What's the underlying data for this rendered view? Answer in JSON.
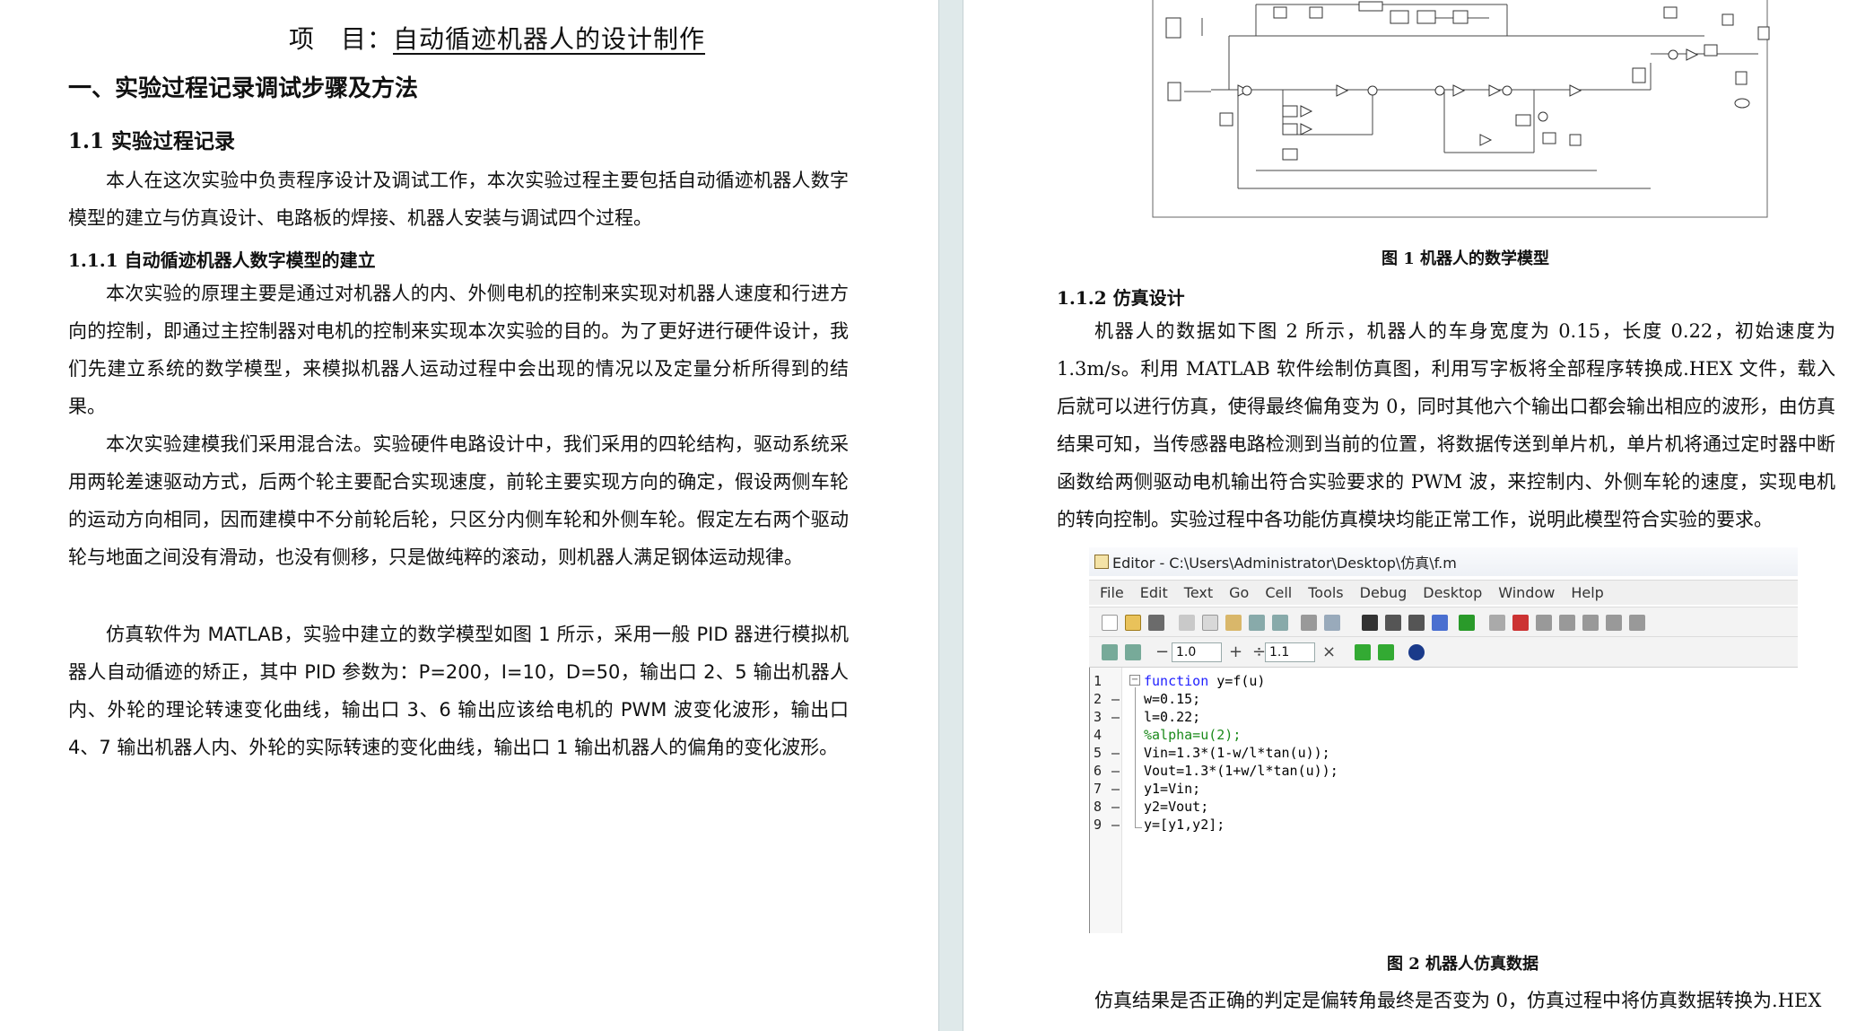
{
  "left": {
    "project_label": "项　目：",
    "project_value": "自动循迹机器人的设计制作",
    "section_heading": "一、实验过程记录调试步骤及方法",
    "sub_1_1": "1.1 实验过程记录",
    "p1": "本人在这次实验中负责程序设计及调试工作，本次实验过程主要包括自动循迹机器人数字模型的建立与仿真设计、电路板的焊接、机器人安装与调试四个过程。",
    "sub_1_1_1": "1.1.1 自动循迹机器人数字模型的建立",
    "p2": "本次实验的原理主要是通过对机器人的内、外侧电机的控制来实现对机器人速度和行进方向的控制，即通过主控制器对电机的控制来实现本次实验的目的。为了更好进行硬件设计，我们先建立系统的数学模型，来模拟机器人运动过程中会出现的情况以及定量分析所得到的结果。",
    "p3": "本次实验建模我们采用混合法。实验硬件电路设计中，我们采用的四轮结构，驱动系统采用两轮差速驱动方式，后两个轮主要配合实现速度，前轮主要实现方向的确定，假设两侧车轮的运动方向相同，因而建模中不分前轮后轮，只区分内侧车轮和外侧车轮。假定左右两个驱动轮与地面之间没有滑动，也没有侧移，只是做纯粹的滚动，则机器人满足钢体运动规律。",
    "p4": "仿真软件为 MATLAB，实验中建立的数学模型如图 1 所示，采用一般 PID 器进行模拟机器人自动循迹的矫正，其中 PID 参数为：P=200，I=10，D=50，输出口 2、5 输出机器人内、外轮的理论转速变化曲线，输出口 3、6 输出应该给电机的 PWM 波变化波形，输出口 4、7 输出机器人内、外轮的实际转速的变化曲线，输出口 1 输出机器人的偏角的变化波形。"
  },
  "right": {
    "fig1_caption": "图 1  机器人的数学模型",
    "sub_1_1_2": "1.1.2 仿真设计",
    "p5": "机器人的数据如下图 2 所示，机器人的车身宽度为 0.15，长度 0.22，初始速度为 1.3m/s。利用 MATLAB 软件绘制仿真图，利用写字板将全部程序转换成.HEX 文件，载入后就可以进行仿真，使得最终偏角变为 0，同时其他六个输出口都会输出相应的波形，由仿真结果可知，当传感器电路检测到当前的位置，将数据传送到单片机，单片机将通过定时器中断函数给两侧驱动电机输出符合实验要求的 PWM 波，来控制内、外侧车轮的速度，实现电机的转向控制。实验过程中各功能仿真模块均能正常工作，说明此模型符合实验的要求。",
    "fig2_caption": "图 2  机器人仿真数据",
    "p6": "仿真结果是否正确的判定是偏转角最终是否变为 0，仿真过程中将仿真数据转换为.HEX"
  },
  "editor": {
    "title": "Editor - C:\\Users\\Administrator\\Desktop\\仿真\\f.m",
    "menu": [
      "File",
      "Edit",
      "Text",
      "Go",
      "Cell",
      "Tools",
      "Debug",
      "Desktop",
      "Window",
      "Help"
    ],
    "field1": "1.0",
    "field2": "1.1",
    "line_numbers": [
      "1",
      "2",
      "3",
      "4",
      "5",
      "6",
      "7",
      "8",
      "9"
    ],
    "code": {
      "l1_kw": "function",
      "l1_rest": " y=f(u)",
      "l2": "w=0.15;",
      "l3": "l=0.22;",
      "l4": "%alpha=u(2);",
      "l5": "Vin=1.3*(1-w/l*tan(u));",
      "l6": "Vout=1.3*(1+w/l*tan(u));",
      "l7": "y1=Vin;",
      "l8": "y2=Vout;",
      "l9": "y=[y1,y2];"
    }
  }
}
